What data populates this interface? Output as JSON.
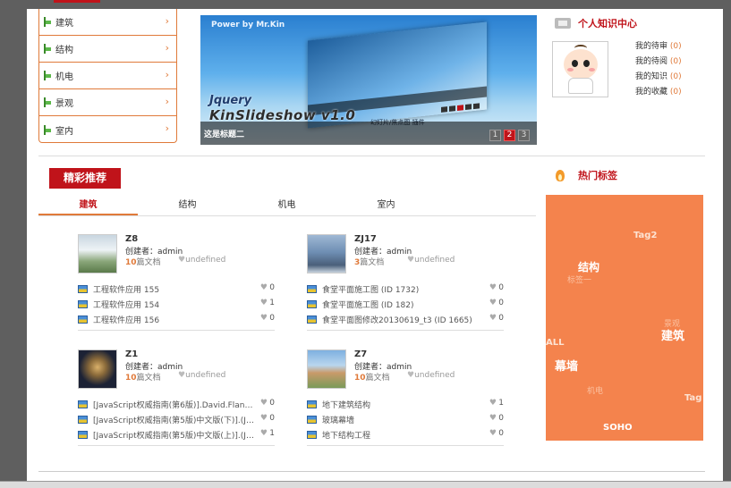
{
  "categories": [
    {
      "label": "建筑"
    },
    {
      "label": "结构"
    },
    {
      "label": "机电"
    },
    {
      "label": "景观"
    },
    {
      "label": "室内"
    }
  ],
  "slideshow": {
    "power_text": "Power by Mr.Kin",
    "brand_line1": "Jquery",
    "brand_line2": "KinSlideshow v1.0",
    "brand_sub": "幻灯片/焦点图 插件",
    "caption": "这是标题二",
    "pages": [
      "1",
      "2",
      "3"
    ],
    "active_page": "2"
  },
  "personal_center": {
    "title": "个人知识中心",
    "links": [
      {
        "label": "我的待审",
        "count": "(0)"
      },
      {
        "label": "我的待阅",
        "count": "(0)"
      },
      {
        "label": "我的知识",
        "count": "(0)"
      },
      {
        "label": "我的收藏",
        "count": "(0)"
      }
    ]
  },
  "featured": {
    "title": "精彩推荐",
    "tabs": [
      "建筑",
      "结构",
      "机电",
      "室内"
    ],
    "active_tab": "建筑",
    "cards": [
      {
        "code": "Z8",
        "creator_label": "创建者：",
        "creator": "admin",
        "doc_count": "10",
        "doc_suffix": "篇文档",
        "undefined_text": "undefined",
        "items": [
          {
            "name": "工程软件应用 155",
            "count": "0"
          },
          {
            "name": "工程软件应用 154",
            "count": "1"
          },
          {
            "name": "工程软件应用 156",
            "count": "0"
          }
        ]
      },
      {
        "code": "ZJ17",
        "creator_label": "创建者：",
        "creator": "admin",
        "doc_count": "3",
        "doc_suffix": "篇文档",
        "undefined_text": "undefined",
        "items": [
          {
            "name": "食堂平面施工图 (ID 1732)",
            "count": "0"
          },
          {
            "name": "食堂平面施工图 (ID 182)",
            "count": "0"
          },
          {
            "name": "食堂平面图修改20130619_t3 (ID 1665)",
            "count": "0"
          }
        ]
      },
      {
        "code": "Z1",
        "creator_label": "创建者：",
        "creator": "admin",
        "doc_count": "10",
        "doc_suffix": "篇文档",
        "undefined_text": "undefined",
        "items": [
          {
            "name": "[JavaScript权威指南(第6版)].David.Flanaga...",
            "count": "0"
          },
          {
            "name": "[JavaScript权威指南(第5版)中文版(下)].(Java...",
            "count": "0"
          },
          {
            "name": "[JavaScript权威指南(第5版)中文版(上)].(Java...",
            "count": "1"
          }
        ]
      },
      {
        "code": "Z7",
        "creator_label": "创建者：",
        "creator": "admin",
        "doc_count": "10",
        "doc_suffix": "篇文档",
        "undefined_text": "undefined",
        "items": [
          {
            "name": "地下建筑结构",
            "count": "1"
          },
          {
            "name": "玻璃幕墙",
            "count": "0"
          },
          {
            "name": "地下结构工程",
            "count": "0"
          }
        ]
      }
    ]
  },
  "hot_tags": {
    "title": "热门标签",
    "tags": [
      {
        "label": "Tag2"
      },
      {
        "label": "结构"
      },
      {
        "label": "标签一"
      },
      {
        "label": "景观"
      },
      {
        "label": "建筑"
      },
      {
        "label": "ALL"
      },
      {
        "label": "幕墙"
      },
      {
        "label": "机电"
      },
      {
        "label": "Tag"
      },
      {
        "label": "SOHO"
      }
    ]
  },
  "colors": {
    "accent_red": "#c0131a",
    "accent_orange": "#e07a3a",
    "tag_bg": "#f4834d"
  }
}
